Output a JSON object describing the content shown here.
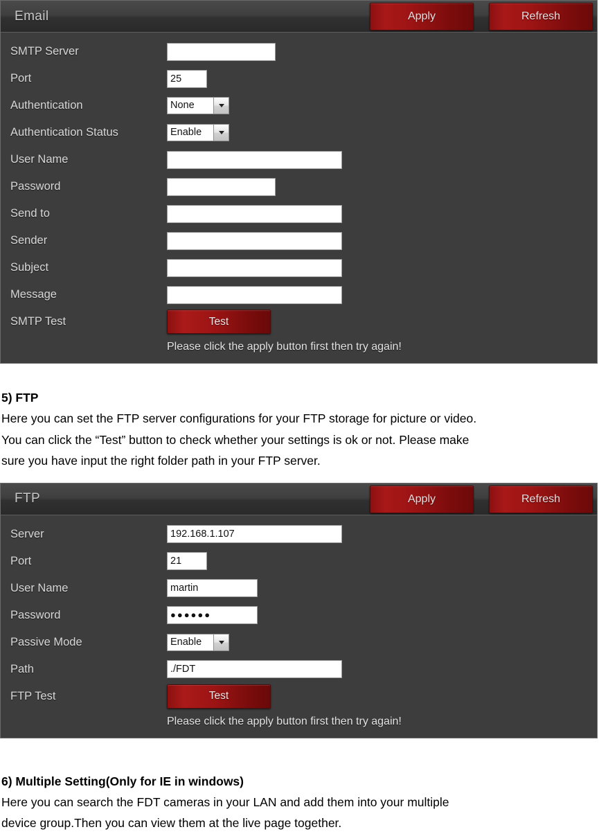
{
  "email_panel": {
    "title": "Email",
    "apply_label": "Apply",
    "refresh_label": "Refresh",
    "fields": {
      "smtp_server": {
        "label": "SMTP Server",
        "value": ""
      },
      "port": {
        "label": "Port",
        "value": "25"
      },
      "authentication": {
        "label": "Authentication",
        "value": "None"
      },
      "authentication_status": {
        "label": "Authentication Status",
        "value": "Enable"
      },
      "user_name": {
        "label": "User Name",
        "value": ""
      },
      "password": {
        "label": "Password",
        "value": ""
      },
      "send_to": {
        "label": "Send to",
        "value": ""
      },
      "sender": {
        "label": "Sender",
        "value": ""
      },
      "subject": {
        "label": "Subject",
        "value": ""
      },
      "message": {
        "label": "Message",
        "value": ""
      },
      "smtp_test": {
        "label": "SMTP Test",
        "button_label": "Test"
      }
    },
    "hint": "Please click the apply button first then try again!"
  },
  "section_ftp": {
    "heading": "5) FTP",
    "paragraph_line1": "Here you can set the FTP server configurations for your FTP storage for picture or video.",
    "paragraph_line2": "You can click the “Test” button to check whether your settings is ok or not. Please make",
    "paragraph_line3": "sure you have input the right folder path in your FTP server."
  },
  "ftp_panel": {
    "title": "FTP",
    "apply_label": "Apply",
    "refresh_label": "Refresh",
    "fields": {
      "server": {
        "label": "Server",
        "value": "192.168.1.107"
      },
      "port": {
        "label": "Port",
        "value": "21"
      },
      "user_name": {
        "label": "User Name",
        "value": "martin"
      },
      "password": {
        "label": "Password",
        "value": "●●●●●●"
      },
      "passive_mode": {
        "label": "Passive Mode",
        "value": "Enable"
      },
      "path": {
        "label": "Path",
        "value": "./FDT"
      },
      "ftp_test": {
        "label": "FTP Test",
        "button_label": "Test"
      }
    },
    "hint": "Please click the apply button first then try again!"
  },
  "section_multiple": {
    "heading": "6) Multiple Setting(Only for IE in windows)",
    "paragraph_line1": "Here you can search the FDT cameras in your LAN and add them into your multiple",
    "paragraph_line2": "device group.Then you can view them at the live page together."
  },
  "colors": {
    "panel_background": "#3d3d3d",
    "header_gradient_top": "#4a4a4a",
    "button_red": "#a81818",
    "label_text": "#d8d8d8",
    "field_background": "#ffffff"
  }
}
